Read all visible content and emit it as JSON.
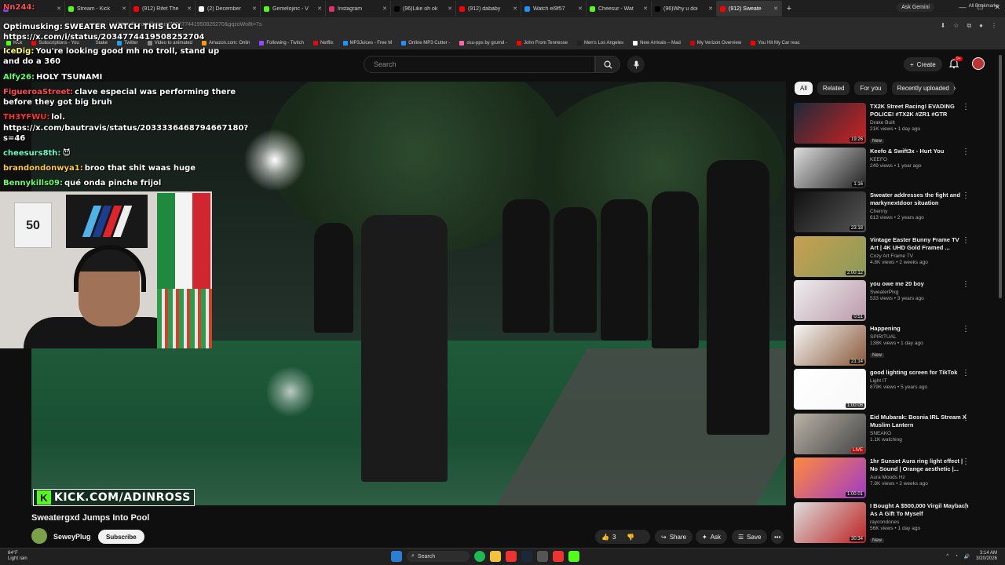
{
  "browser": {
    "tabs": [
      {
        "label": "",
        "color": "#9146ff"
      },
      {
        "label": "Stream - Kick",
        "color": "#53fc18"
      },
      {
        "label": "(912) Rifet The",
        "color": "#ff0000"
      },
      {
        "label": "(2) December",
        "color": "#ffffff"
      },
      {
        "label": "Gemelojinc - V",
        "color": "#53fc18"
      },
      {
        "label": "Instagram",
        "color": "#e1306c"
      },
      {
        "label": "(96)Like oh ok",
        "color": "#000000"
      },
      {
        "label": "(912) dababy",
        "color": "#ff0000"
      },
      {
        "label": "Watch el9f57",
        "color": "#1e90ff"
      },
      {
        "label": "Cheesur - Wat",
        "color": "#53fc18"
      },
      {
        "label": "(96)Why u doi",
        "color": "#000000"
      },
      {
        "label": "(912) Sweate",
        "color": "#ff0000",
        "active": true
      }
    ],
    "ask_gemini": "Ask Gemini",
    "url": "https://x.com/i/status/203477441950825270&gqzoWo8t=7s",
    "bookmarks": [
      {
        "label": "Kick",
        "color": "#53fc18"
      },
      {
        "label": "Subscriptions - You",
        "color": "#ff0000"
      },
      {
        "label": "Stake",
        "color": "#1a2c38"
      },
      {
        "label": "Twitter",
        "color": "#1da1f2"
      },
      {
        "label": "Video to animated",
        "color": "#888888"
      },
      {
        "label": "Amazon.com: Onlin",
        "color": "#ff9900"
      },
      {
        "label": "Following - Twitch",
        "color": "#9146ff"
      },
      {
        "label": "Netflix",
        "color": "#e50914"
      },
      {
        "label": "MP3Juices - Free M",
        "color": "#1e90ff"
      },
      {
        "label": "Online MP3 Cutter -",
        "color": "#1e90ff"
      },
      {
        "label": "osu-pps by grumd -",
        "color": "#ff66aa"
      },
      {
        "label": "John From Tennesse",
        "color": "#ff0000"
      },
      {
        "label": "Men's Los Angeles",
        "color": "#222222"
      },
      {
        "label": "New Arrivals – Mad",
        "color": "#ffffff"
      },
      {
        "label": "My Verizon Overview",
        "color": "#cd040b"
      },
      {
        "label": "You Hit My Car reac",
        "color": "#ff0000"
      }
    ],
    "all_bookmarks": "All Bookmarks"
  },
  "youtube": {
    "search_placeholder": "Search",
    "create_label": "Create",
    "notif_count": "9+",
    "video_title": "Sweatergxd Jumps Into Pool",
    "channel_name": "SeweyPlug",
    "subscribe_label": "Subscribe",
    "like_count": "3",
    "share_label": "Share",
    "ask_label": "Ask",
    "save_label": "Save",
    "watermark": "KICK.COM/ADINROSS",
    "chips": [
      "All",
      "Related",
      "For you",
      "Recently uploaded"
    ],
    "recommendations": [
      {
        "title": "TX2K Street Racing! EVADING POLICE! #TX2K #ZR1 #GTR",
        "channel": "Drake Built",
        "stats": "21K views • 1 day ago",
        "badge": "New",
        "duration": "19:26",
        "colors": [
          "#1d2a3a",
          "#c22"
        ]
      },
      {
        "title": "Keefo & Swift3x - Hurt You",
        "channel": "KEEFO",
        "stats": "249 views • 1 year ago",
        "badge": "",
        "duration": "1:16",
        "colors": [
          "#ddd",
          "#222"
        ]
      },
      {
        "title": "Sweater addresses the fight and markynextdoor situation",
        "channel": "Chenny",
        "stats": "613 views • 2 years ago",
        "badge": "",
        "duration": "23:18",
        "colors": [
          "#111",
          "#555"
        ]
      },
      {
        "title": "Vintage Easter Bunny Frame TV Art | 4K UHD Gold Framed ...",
        "channel": "Cozy Art Frame TV",
        "stats": "4.8K views • 2 weeks ago",
        "badge": "",
        "duration": "2:00:12",
        "colors": [
          "#c8a050",
          "#8a9a5a"
        ]
      },
      {
        "title": "you owe me 20 boy",
        "channel": "SweaterPlxg",
        "stats": "533 views • 3 years ago",
        "badge": "",
        "duration": "0:51",
        "colors": [
          "#eee",
          "#b9a"
        ]
      },
      {
        "title": "Happening",
        "channel": "SPIRITUAL",
        "stats": "138K views • 1 day ago",
        "badge": "New",
        "duration": "21:14",
        "colors": [
          "#f6f6f6",
          "#8a5a3a"
        ]
      },
      {
        "title": "good lighting screen for TikTok",
        "channel": "Light IT",
        "stats": "879K views • 5 years ago",
        "badge": "",
        "duration": "1:00:06",
        "colors": [
          "#ffffff",
          "#f8f8f8"
        ]
      },
      {
        "title": "Eid Mubarak: Bosnia IRL Stream X Muslim Lantern",
        "channel": "SNEAKO",
        "stats": "1.1K watching",
        "badge": "",
        "duration": "LIVE",
        "colors": [
          "#b9b2a6",
          "#444"
        ]
      },
      {
        "title": "1hr Sunset Aura ring light effect | No Sound | Orange aesthetic |...",
        "channel": "Aura Moods Hz",
        "stats": "7.8K views • 2 weeks ago",
        "badge": "",
        "duration": "1:00:01",
        "colors": [
          "#ff8a3a",
          "#a03ac8"
        ]
      },
      {
        "title": "I Bought A $500,000 Virgil Maybach As A Gift To Myself",
        "channel": "raycondones",
        "stats": "56K views • 1 day ago",
        "badge": "New",
        "duration": "30:34",
        "colors": [
          "#ddd",
          "#b22"
        ]
      }
    ]
  },
  "chat": [
    {
      "user": "Nn244:",
      "user_color": "#ff4d4d",
      "msg": ""
    },
    {
      "user": "Optimusking:",
      "user_color": "#ffffff",
      "msg": "SWEATER WATCH THIS LOL"
    },
    {
      "user": "",
      "user_color": "#ffffff",
      "msg": "https://x.com/i/status/2034774419508252704"
    },
    {
      "user": "IceDig:",
      "user_color": "#ffff66",
      "msg": "You're looking good mh no troll, stand up"
    },
    {
      "user": "",
      "user_color": "#ffffff",
      "msg": "and do a 360"
    },
    {
      "user": "Alfy26:",
      "user_color": "#66ff66",
      "msg": "HOLY TSUNAMI"
    },
    {
      "user": "FiguerоаStreet:",
      "user_color": "#ff4d4d",
      "msg": "clave especial was performing there"
    },
    {
      "user": "",
      "user_color": "#ffffff",
      "msg": "before they got big bruh"
    },
    {
      "user": "TH3YFWU:",
      "user_color": "#ff3333",
      "msg": "lol."
    },
    {
      "user": "",
      "user_color": "#ffffff",
      "msg": "https://x.com/bautravis/status/2033336468794667180?"
    },
    {
      "user": "",
      "user_color": "#ffffff",
      "msg": "s=46"
    },
    {
      "user": "cheesurs8th:",
      "user_color": "#66ffcc",
      "msg": "😈"
    },
    {
      "user": "brandondonwya1:",
      "user_color": "#ffcc33",
      "msg": "broo that shit waas huge"
    },
    {
      "user": "Bennykills09:",
      "user_color": "#66ff66",
      "msg": "qué onda pinche frijol"
    }
  ],
  "taskbar": {
    "weather_temp": "64°F",
    "weather_desc": "Light rain",
    "search_label": "Search",
    "time": "3:14 AM",
    "date": "3/20/2026"
  },
  "webcam": {
    "jersey_number": "50"
  }
}
